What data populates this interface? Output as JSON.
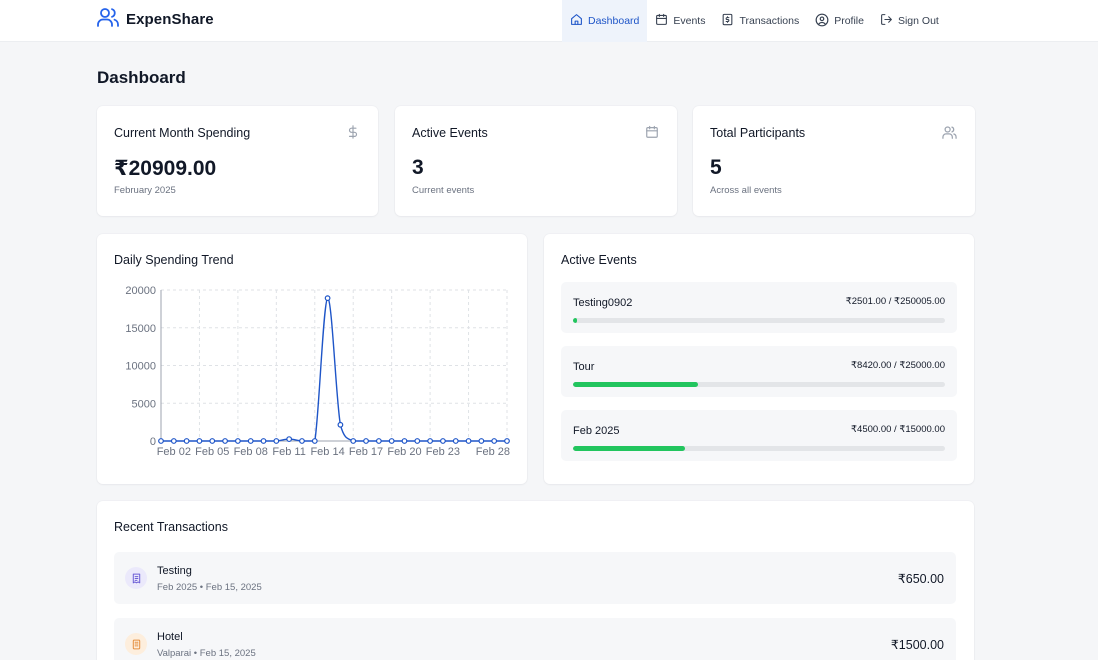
{
  "app": {
    "name": "ExpenShare"
  },
  "nav": {
    "items": [
      {
        "label": "Dashboard",
        "icon": "home-icon",
        "active": true
      },
      {
        "label": "Events",
        "icon": "calendar-icon",
        "active": false
      },
      {
        "label": "Transactions",
        "icon": "receipt-dollar-icon",
        "active": false
      },
      {
        "label": "Profile",
        "icon": "user-circle-icon",
        "active": false
      },
      {
        "label": "Sign Out",
        "icon": "sign-out-icon",
        "active": false
      }
    ]
  },
  "page": {
    "title": "Dashboard"
  },
  "stats": [
    {
      "title": "Current Month Spending",
      "value": "₹20909.00",
      "sub": "February 2025",
      "icon": "dollar-icon"
    },
    {
      "title": "Active Events",
      "value": "3",
      "sub": "Current events",
      "icon": "calendar-icon"
    },
    {
      "title": "Total Participants",
      "value": "5",
      "sub": "Across all events",
      "icon": "users-icon"
    }
  ],
  "trend": {
    "title": "Daily Spending Trend"
  },
  "chart_data": {
    "type": "line",
    "title": "Daily Spending Trend",
    "xlabel": "",
    "ylabel": "",
    "x": [
      "Feb 01",
      "Feb 02",
      "Feb 03",
      "Feb 04",
      "Feb 05",
      "Feb 06",
      "Feb 07",
      "Feb 08",
      "Feb 09",
      "Feb 10",
      "Feb 11",
      "Feb 12",
      "Feb 13",
      "Feb 14",
      "Feb 15",
      "Feb 16",
      "Feb 17",
      "Feb 18",
      "Feb 19",
      "Feb 20",
      "Feb 21",
      "Feb 22",
      "Feb 23",
      "Feb 24",
      "Feb 25",
      "Feb 26",
      "Feb 27",
      "Feb 28"
    ],
    "series": [
      {
        "values": [
          0,
          0,
          0,
          0,
          0,
          0,
          0,
          0,
          0,
          0,
          250,
          0,
          0,
          18919,
          2150,
          0,
          0,
          0,
          0,
          0,
          0,
          0,
          0,
          0,
          0,
          0,
          0,
          0
        ]
      }
    ],
    "xticks": [
      "Feb 02",
      "Feb 05",
      "Feb 08",
      "Feb 11",
      "Feb 14",
      "Feb 17",
      "Feb 20",
      "Feb 23",
      "Feb 28"
    ],
    "yticks": [
      0,
      5000,
      10000,
      15000,
      20000
    ],
    "ylim": [
      0,
      20000
    ],
    "grid": true,
    "color": "#1e55c8"
  },
  "active_events": {
    "title": "Active Events",
    "items": [
      {
        "name": "Testing0902",
        "amount": "₹2501.00 / ₹250005.00",
        "spent": 2501,
        "budget": 250005
      },
      {
        "name": "Tour",
        "amount": "₹8420.00 / ₹25000.00",
        "spent": 8420,
        "budget": 25000
      },
      {
        "name": "Feb 2025",
        "amount": "₹4500.00 / ₹15000.00",
        "spent": 4500,
        "budget": 15000
      }
    ]
  },
  "transactions": {
    "title": "Recent Transactions",
    "items": [
      {
        "name": "Testing",
        "meta": "Feb 2025 • Feb 15, 2025",
        "amount": "₹650.00",
        "icon": "receipt-icon",
        "icon_bg": "#ebe9fb",
        "icon_color": "#6d5fd6"
      },
      {
        "name": "Hotel",
        "meta": "Valparai • Feb 15, 2025",
        "amount": "₹1500.00",
        "icon": "building-icon",
        "icon_bg": "#fdeedd",
        "icon_color": "#e59040"
      }
    ]
  }
}
